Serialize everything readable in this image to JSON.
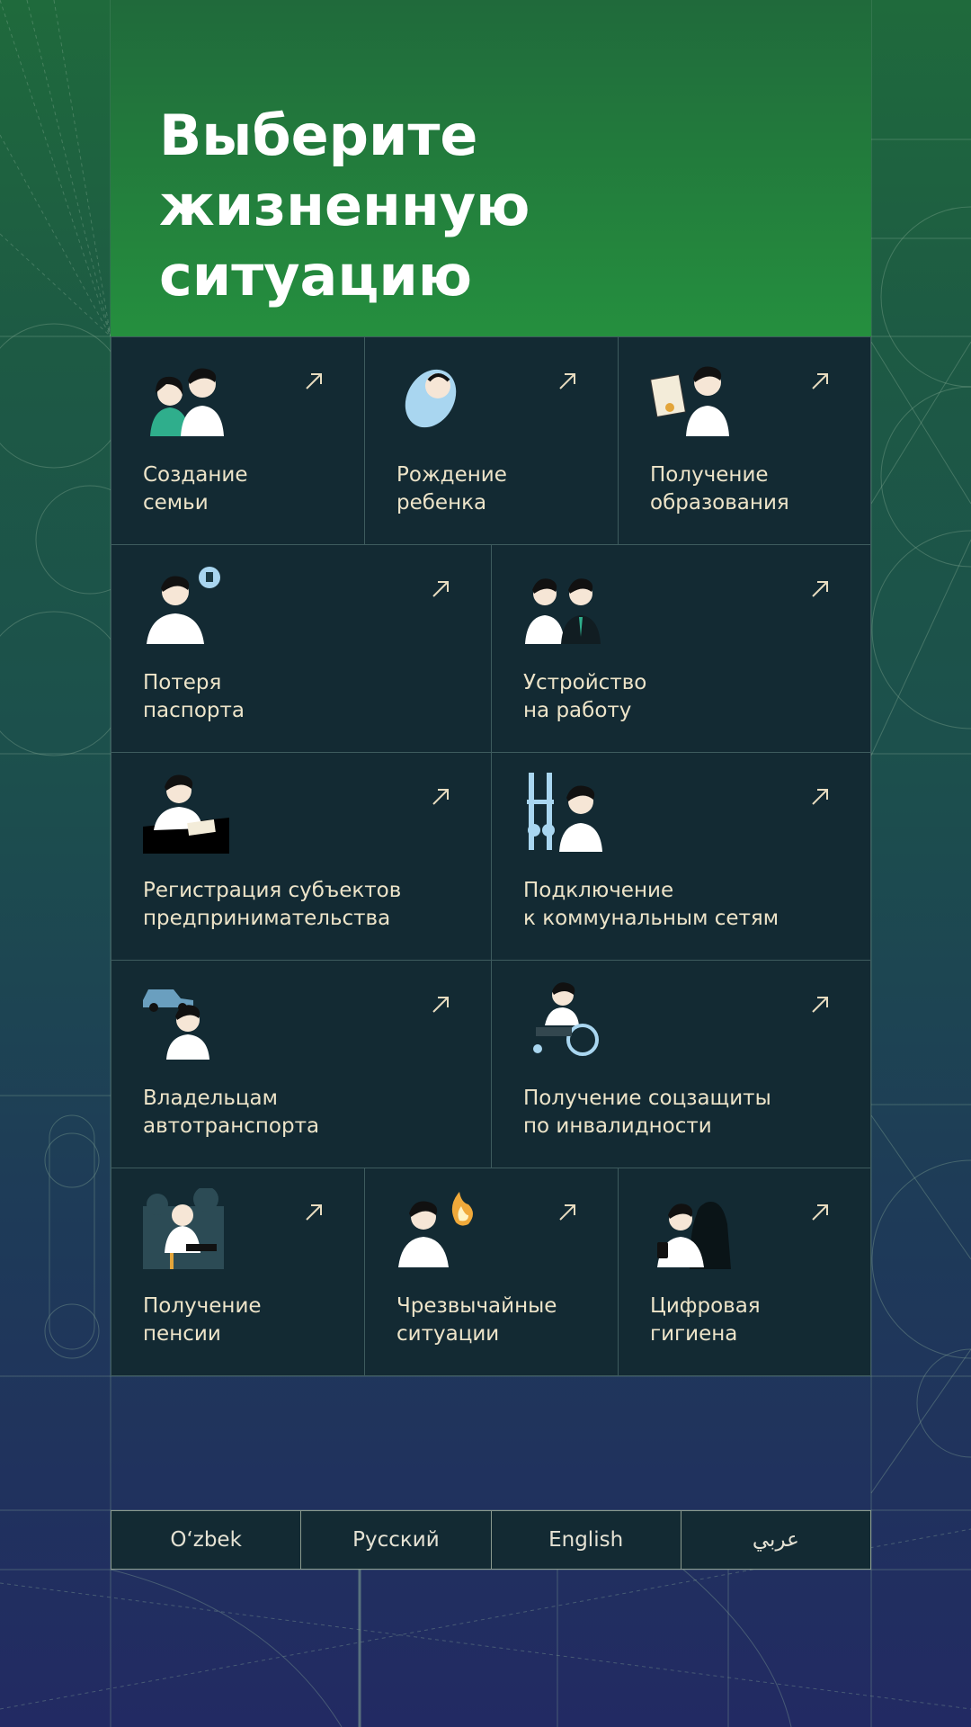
{
  "header": {
    "title_line1": "Выберите",
    "title_line2": "жизненную ситуацию"
  },
  "situations": [
    {
      "label": "Создание\nсемьи",
      "icon": "family-couple-icon"
    },
    {
      "label": "Рождение\nребенка",
      "icon": "baby-icon"
    },
    {
      "label": "Получение\nобразования",
      "icon": "diploma-icon"
    },
    {
      "label": "Потеря\nпаспорта",
      "icon": "lost-passport-icon"
    },
    {
      "label": "Устройство\nна работу",
      "icon": "handshake-icon"
    },
    {
      "label": "Регистрация субъектов\nпредпринимательства",
      "icon": "signing-document-icon"
    },
    {
      "label": "Подключение\nк коммунальным сетям",
      "icon": "utility-pipes-icon"
    },
    {
      "label": "Владельцам\nавтотранспорта",
      "icon": "car-owner-icon"
    },
    {
      "label": "Получение соцзащиты\nпо инвалидности",
      "icon": "wheelchair-icon"
    },
    {
      "label": "Получение\nпенсии",
      "icon": "pensioner-icon"
    },
    {
      "label": "Чрезвычайные\nситуации",
      "icon": "emergency-fire-icon"
    },
    {
      "label": "Цифровая\nгигиена",
      "icon": "digital-hygiene-icon"
    }
  ],
  "languages": [
    "O‘zbek",
    "Русский",
    "English",
    "عربي"
  ],
  "colors": {
    "tile_bg": "#132a33",
    "tile_border": "#3e5b5e",
    "label_text": "#ede4c9",
    "header_green": "#258f3e"
  }
}
